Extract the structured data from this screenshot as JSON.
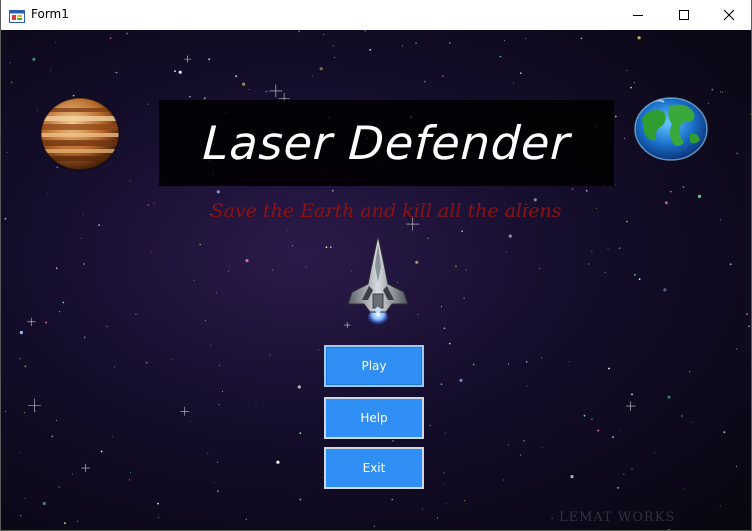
{
  "window": {
    "title": "Form1",
    "controls": {
      "minimize_icon": "minimize-icon",
      "maximize_icon": "maximize-icon",
      "close_icon": "close-icon"
    }
  },
  "game": {
    "title": "Laser Defender",
    "tagline": "Save the Earth and kill all the aliens",
    "tagline_color": "#8b1313"
  },
  "menu": {
    "play_label": "Play",
    "help_label": "Help",
    "exit_label": "Exit",
    "button_color": "#2f8ff5"
  },
  "watermark": "LEMAT WORKS"
}
